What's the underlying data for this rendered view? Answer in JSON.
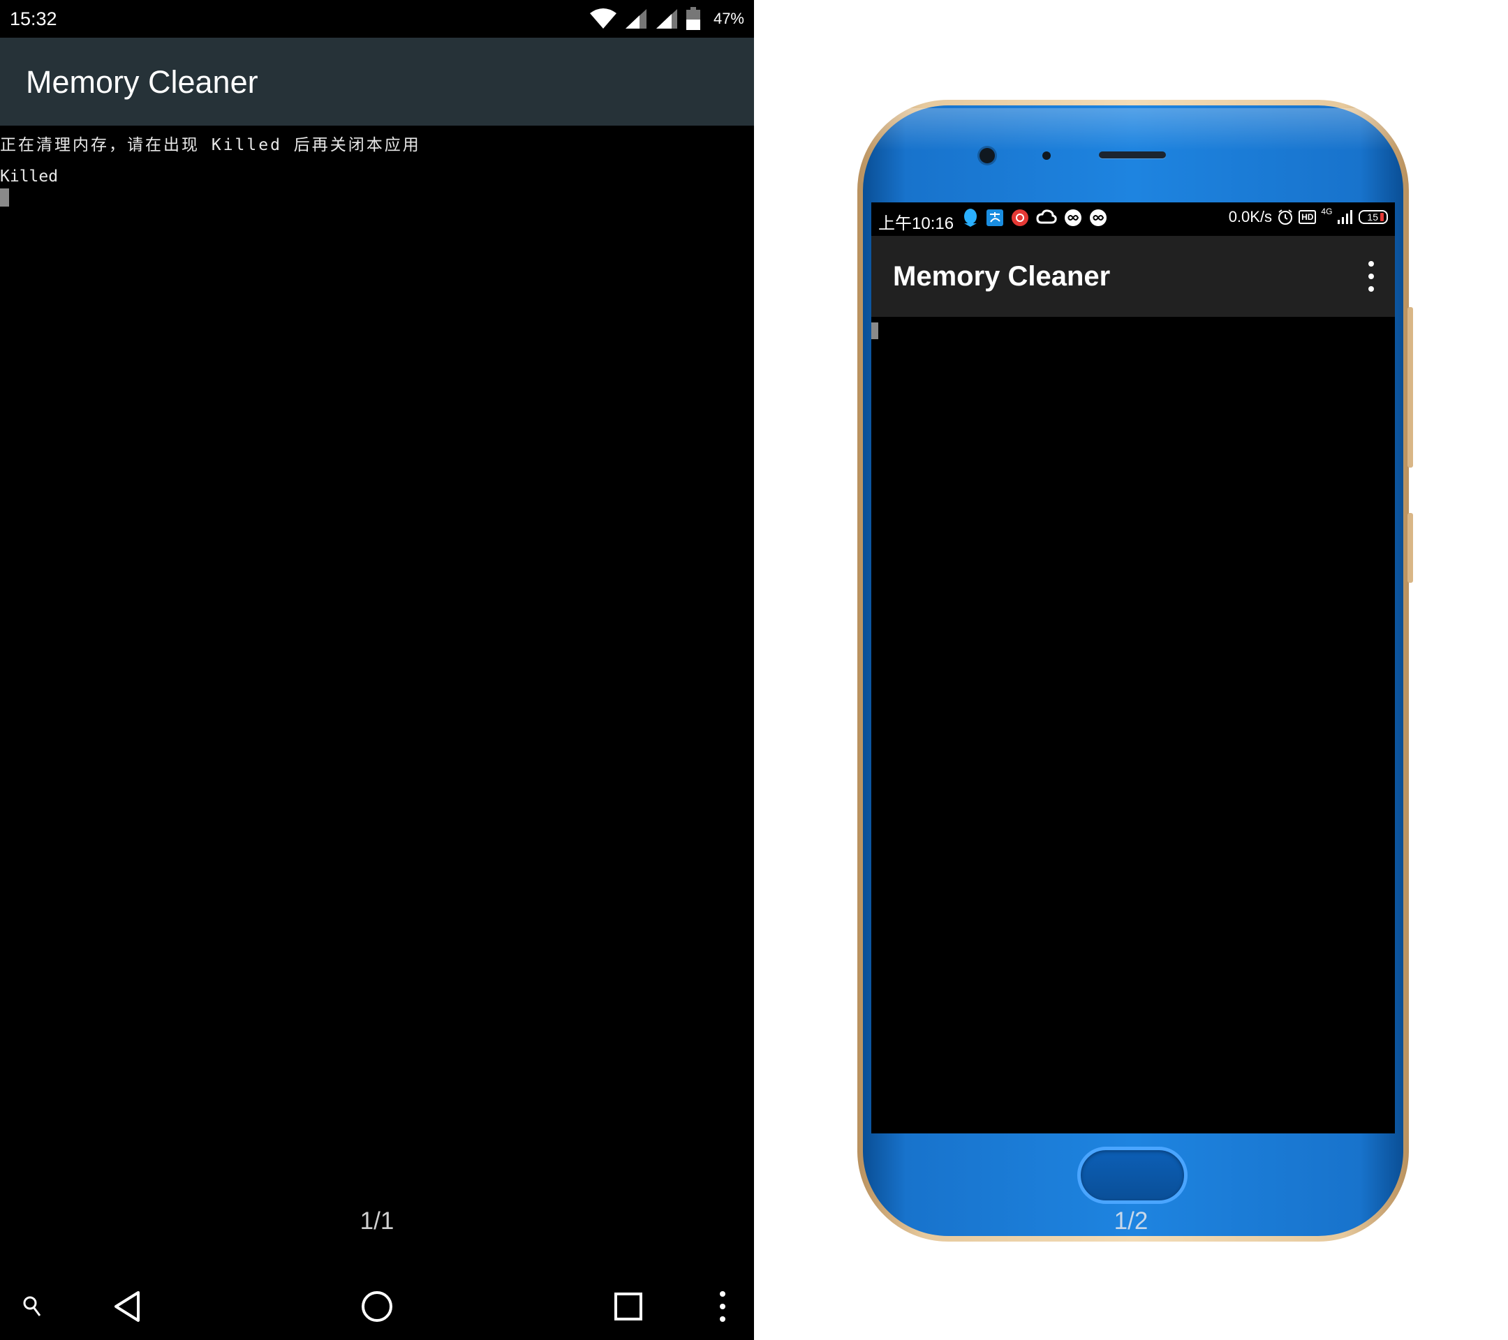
{
  "left": {
    "status_bar": {
      "time": "15:32",
      "battery_percent": "47%"
    },
    "app_bar": {
      "title": "Memory Cleaner"
    },
    "terminal": {
      "line1": "正在清理内存，请在出现 Killed 后再关闭本应用",
      "line2": "Killed"
    },
    "page_indicator": "1/1",
    "nav_bar": {
      "icons": [
        "search-icon",
        "back-icon",
        "home-icon",
        "recents-icon",
        "overflow-menu-icon"
      ]
    }
  },
  "right": {
    "status_bar": {
      "time": "上午10:16",
      "network_speed": "0.0K/s",
      "signal_label": "4G",
      "battery_level": "15",
      "hd_label": "HD"
    },
    "app_bar": {
      "title": "Memory Cleaner"
    },
    "page_indicator": "1/2"
  },
  "colors": {
    "left_appbar": "#263238",
    "right_appbar": "#212121",
    "phone_body": "#1e84e0",
    "phone_frame": "#e6c99d",
    "cursor": "#8a8a8a"
  }
}
